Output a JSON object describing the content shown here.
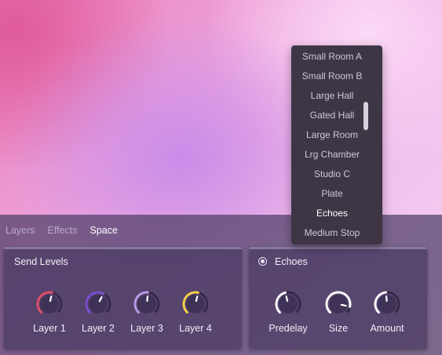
{
  "tabs": [
    "Layers",
    "Effects",
    "Space"
  ],
  "active_tab": "Space",
  "send_levels": {
    "title": "Send Levels",
    "knobs": [
      {
        "label": "Layer 1",
        "color": "#e0506a",
        "value": 0.55
      },
      {
        "label": "Layer 2",
        "color": "#7a4fd0",
        "value": 0.6
      },
      {
        "label": "Layer 3",
        "color": "#b89ae6",
        "value": 0.52
      },
      {
        "label": "Layer 4",
        "color": "#f2d04a",
        "value": 0.55
      }
    ]
  },
  "echoes": {
    "title": "Echoes",
    "knobs": [
      {
        "label": "Predelay",
        "value": 0.45
      },
      {
        "label": "Size",
        "value": 0.88
      },
      {
        "label": "Amount",
        "value": 0.48
      }
    ]
  },
  "dropdown": {
    "items": [
      "Small Room A",
      "Small Room B",
      "Large Hall",
      "Gated Hall",
      "Large Room",
      "Lrg Chamber",
      "Studio C",
      "Plate",
      "Echoes",
      "Medium Stop"
    ],
    "selected": "Echoes"
  }
}
